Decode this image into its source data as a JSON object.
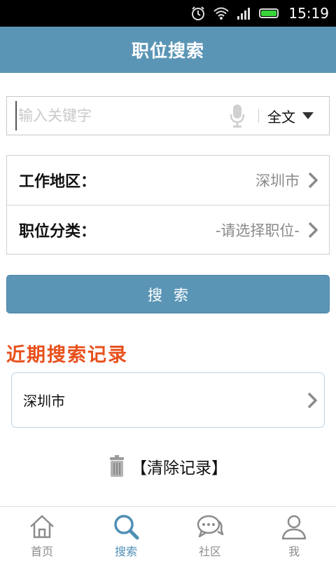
{
  "status_bar": {
    "time": "15:19"
  },
  "header": {
    "title": "职位搜索"
  },
  "search": {
    "placeholder": "输入关键字",
    "scope": "全文"
  },
  "form": {
    "rows": [
      {
        "label": "工作地区：",
        "value": "深圳市"
      },
      {
        "label": "职位分类：",
        "value": "-请选择职位-"
      }
    ]
  },
  "search_button": {
    "label": "搜索"
  },
  "recent": {
    "title": "近期搜索记录",
    "items": [
      "深圳市"
    ],
    "clear_label": "【清除记录】"
  },
  "tabs": [
    {
      "label": "首页",
      "icon": "home-icon"
    },
    {
      "label": "搜索",
      "icon": "search-icon",
      "active": true
    },
    {
      "label": "社区",
      "icon": "chat-bubbles-icon"
    },
    {
      "label": "我",
      "icon": "user-icon"
    }
  ],
  "colors": {
    "accent": "#5b95b6",
    "recent_title": "#e8501c",
    "active_tab": "#4f8fb5"
  }
}
